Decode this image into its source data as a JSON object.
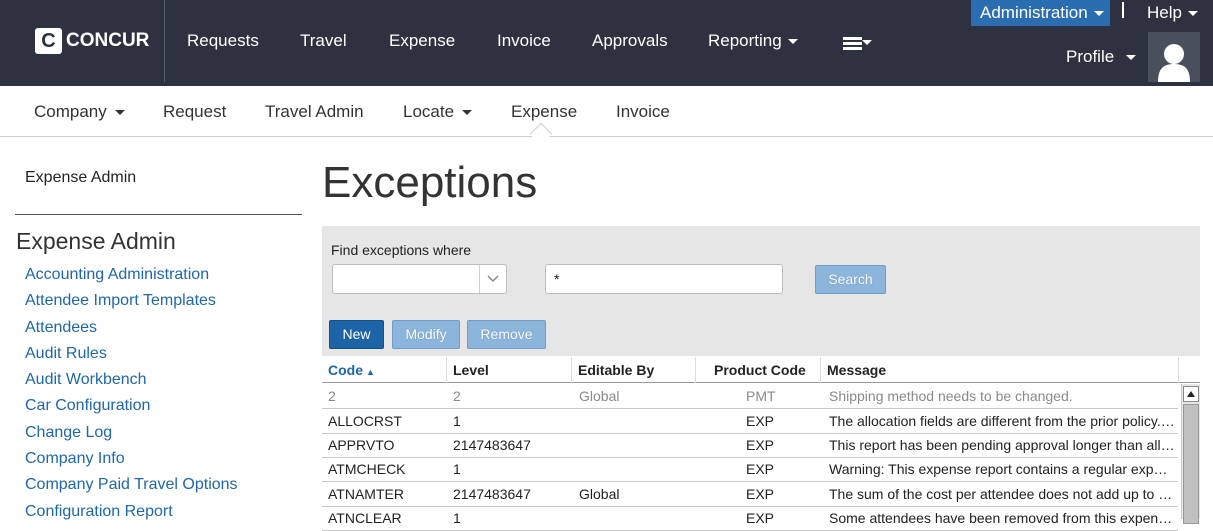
{
  "brand": {
    "logo_letter": "C",
    "logo_text": "CONCUR"
  },
  "topnav": {
    "items": [
      "Requests",
      "Travel",
      "Expense",
      "Invoice",
      "Approvals",
      "Reporting"
    ],
    "administration_label": "Administration",
    "help_label": "Help",
    "profile_label": "Profile"
  },
  "subnav": {
    "items": [
      "Company",
      "Request",
      "Travel Admin",
      "Locate",
      "Expense",
      "Invoice"
    ],
    "active": "Expense"
  },
  "sidebar": {
    "top_link": "Expense Admin",
    "heading": "Expense Admin",
    "links": [
      "Accounting Administration",
      "Attendee Import Templates",
      "Attendees",
      "Audit Rules",
      "Audit Workbench",
      "Car Configuration",
      "Change Log",
      "Company Info",
      "Company Paid Travel Options",
      "Configuration Report"
    ]
  },
  "main": {
    "title": "Exceptions",
    "search": {
      "label": "Find exceptions where",
      "field_value": "",
      "query_value": "*",
      "search_button": "Search"
    },
    "actions": {
      "new": "New",
      "modify": "Modify",
      "remove": "Remove"
    }
  },
  "table": {
    "columns": [
      "Code",
      "Level",
      "Editable By",
      "Product Code",
      "Message"
    ],
    "sort_column": "Code",
    "rows": [
      {
        "code": "2",
        "level": "2",
        "editable_by": "Global",
        "product_code": "PMT",
        "message": "Shipping method needs to be changed.",
        "muted": true
      },
      {
        "code": "ALLOCRST",
        "level": "1",
        "editable_by": "",
        "product_code": "EXP",
        "message": "The allocation fields are different from the prior policy. Please re-allocate."
      },
      {
        "code": "APPRVTO",
        "level": "2147483647",
        "editable_by": "",
        "product_code": "EXP",
        "message": "This report has been pending approval longer than allowed."
      },
      {
        "code": "ATMCHECK",
        "level": "1",
        "editable_by": "",
        "product_code": "EXP",
        "message": "Warning: This expense report contains a regular expense type."
      },
      {
        "code": "ATNAMTER",
        "level": "2147483647",
        "editable_by": "Global",
        "product_code": "EXP",
        "message": "The sum of the cost per attendee does not add up to the total."
      },
      {
        "code": "ATNCLEAR",
        "level": "1",
        "editable_by": "",
        "product_code": "EXP",
        "message": "Some attendees have been removed from this expense."
      }
    ]
  }
}
